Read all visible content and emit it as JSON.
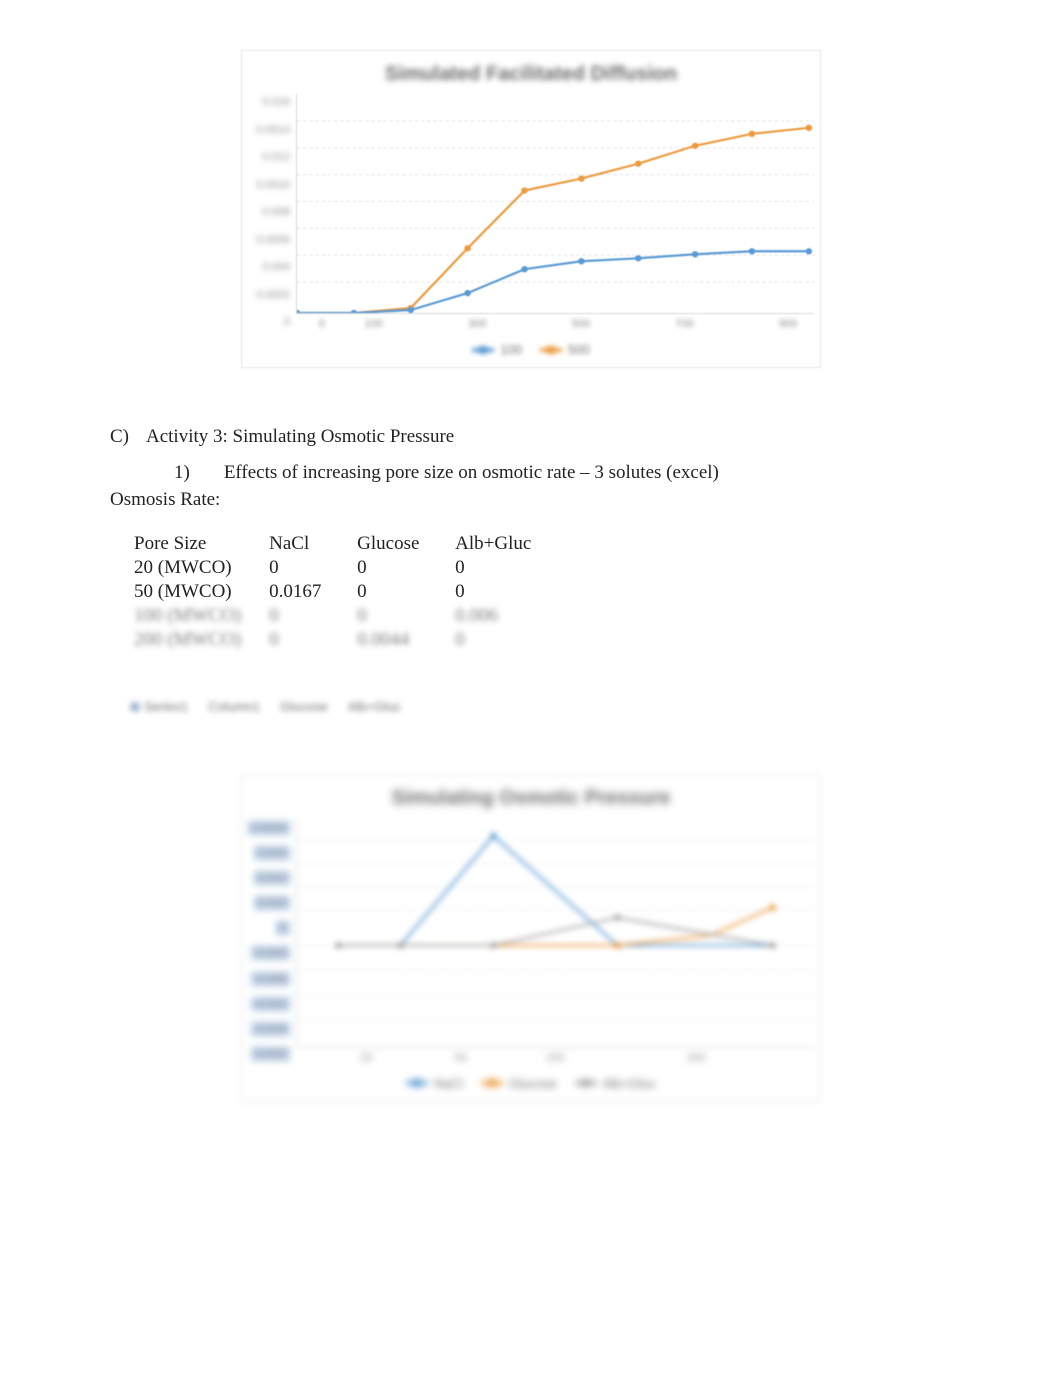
{
  "section": {
    "letter": "C)",
    "title": "Activity 3: Simulating Osmotic Pressure",
    "subnumber": "1)",
    "subtext": "Effects of increasing pore size on osmotic rate – 3 solutes (excel)",
    "osmosis_label": "Osmosis Rate:"
  },
  "table": {
    "headers": [
      "Pore Size",
      "NaCl",
      "Glucose",
      "Alb+Gluc"
    ],
    "rows": [
      [
        "20 (MWCO)",
        "0",
        "0",
        "0"
      ],
      [
        "50 (MWCO)",
        "0.0167",
        "0",
        "0"
      ]
    ],
    "blurred_rows": [
      [
        "100 (MWCO)",
        "0",
        "0",
        "0.006"
      ],
      [
        "200 (MWCO)",
        "0",
        "0.0044",
        "0"
      ]
    ]
  },
  "chart1": {
    "title": "Simulated Facilitated Diffusion",
    "yticks": [
      "0.016",
      "0.0014",
      "0.012",
      "0.0010",
      "0.008",
      "0.0006",
      "0.004",
      "0.0002",
      "0"
    ],
    "xticks": [
      "0",
      "100",
      "",
      "300",
      "",
      "500",
      "",
      "700",
      "",
      "900"
    ],
    "legend": [
      "100",
      "500"
    ]
  },
  "chart2": {
    "top_legend": [
      "Series1",
      "",
      "Column1",
      "",
      "Glucose",
      "Alb+Gluc"
    ],
    "title": "Simulating Osmotic Pressure",
    "yticks": [
      "0.0016",
      "0.014",
      "0.012",
      "0.010",
      "0",
      "-0.004",
      "-0.008",
      "-0.012",
      "-0.016",
      "-0.020"
    ],
    "xticks": [
      "",
      "20",
      "",
      "50",
      "",
      "100",
      "",
      "",
      "200",
      "",
      ""
    ],
    "legend": [
      "NaCl",
      "Glucose",
      "Alb+Gluc"
    ]
  },
  "chart_data": [
    {
      "type": "line",
      "title": "Simulated Facilitated Diffusion",
      "xlabel": "",
      "ylabel": "",
      "ylim": [
        0,
        0.016
      ],
      "x": [
        0,
        100,
        200,
        300,
        400,
        500,
        600,
        700,
        800,
        900
      ],
      "series": [
        {
          "name": "100",
          "values": [
            0,
            0,
            0.0002,
            0.0014,
            0.0032,
            0.0038,
            0.004,
            0.0043,
            0.0045,
            0.0045
          ]
        },
        {
          "name": "500",
          "values": [
            0,
            0,
            0.0004,
            0.0048,
            0.009,
            0.01,
            0.0112,
            0.0124,
            0.0132,
            0.0136
          ]
        }
      ]
    },
    {
      "type": "line",
      "title": "Simulating Osmotic Pressure",
      "xlabel": "Pore Size (MWCO)",
      "ylabel": "",
      "ylim": [
        -0.02,
        0.016
      ],
      "categories": [
        "20",
        "50",
        "100",
        "200"
      ],
      "series": [
        {
          "name": "NaCl",
          "values": [
            0.0,
            0.0167,
            0.0,
            0.0
          ]
        },
        {
          "name": "Glucose",
          "values": [
            0.0,
            0.0,
            0.0,
            0.0044
          ]
        },
        {
          "name": "Alb+Gluc",
          "values": [
            0.0,
            0.0,
            0.006,
            0.0
          ]
        }
      ]
    }
  ]
}
